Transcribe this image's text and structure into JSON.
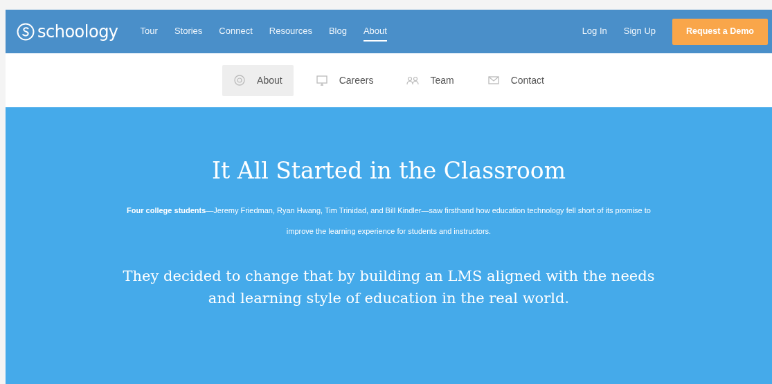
{
  "brand": {
    "name": "schoology"
  },
  "nav": [
    {
      "label": "Tour",
      "selected": false
    },
    {
      "label": "Stories",
      "selected": false
    },
    {
      "label": "Connect",
      "selected": false
    },
    {
      "label": "Resources",
      "selected": false
    },
    {
      "label": "Blog",
      "selected": false
    },
    {
      "label": "About",
      "selected": true
    }
  ],
  "account_links": [
    "Log In",
    "Sign Up"
  ],
  "cta_button": "Request a Demo",
  "subnav": [
    {
      "label": "About",
      "kind": "info",
      "selected": true
    },
    {
      "label": "Careers",
      "kind": "monitor",
      "selected": false
    },
    {
      "label": "Team",
      "kind": "people",
      "selected": false
    },
    {
      "label": "Contact",
      "kind": "mail",
      "selected": false
    }
  ],
  "hero": {
    "title": "It All Started in the Classroom",
    "intro": "**Four college students**—Jeremy Friedman, Ryan Hwang, Tim Trinidad, and Bill Kindler—saw firsthand how education technology fell short of its promise to improve the learning experience for students and instructors.",
    "statement": "They decided to change that by building an LMS aligned with the needs and learning style of education in the real world."
  }
}
